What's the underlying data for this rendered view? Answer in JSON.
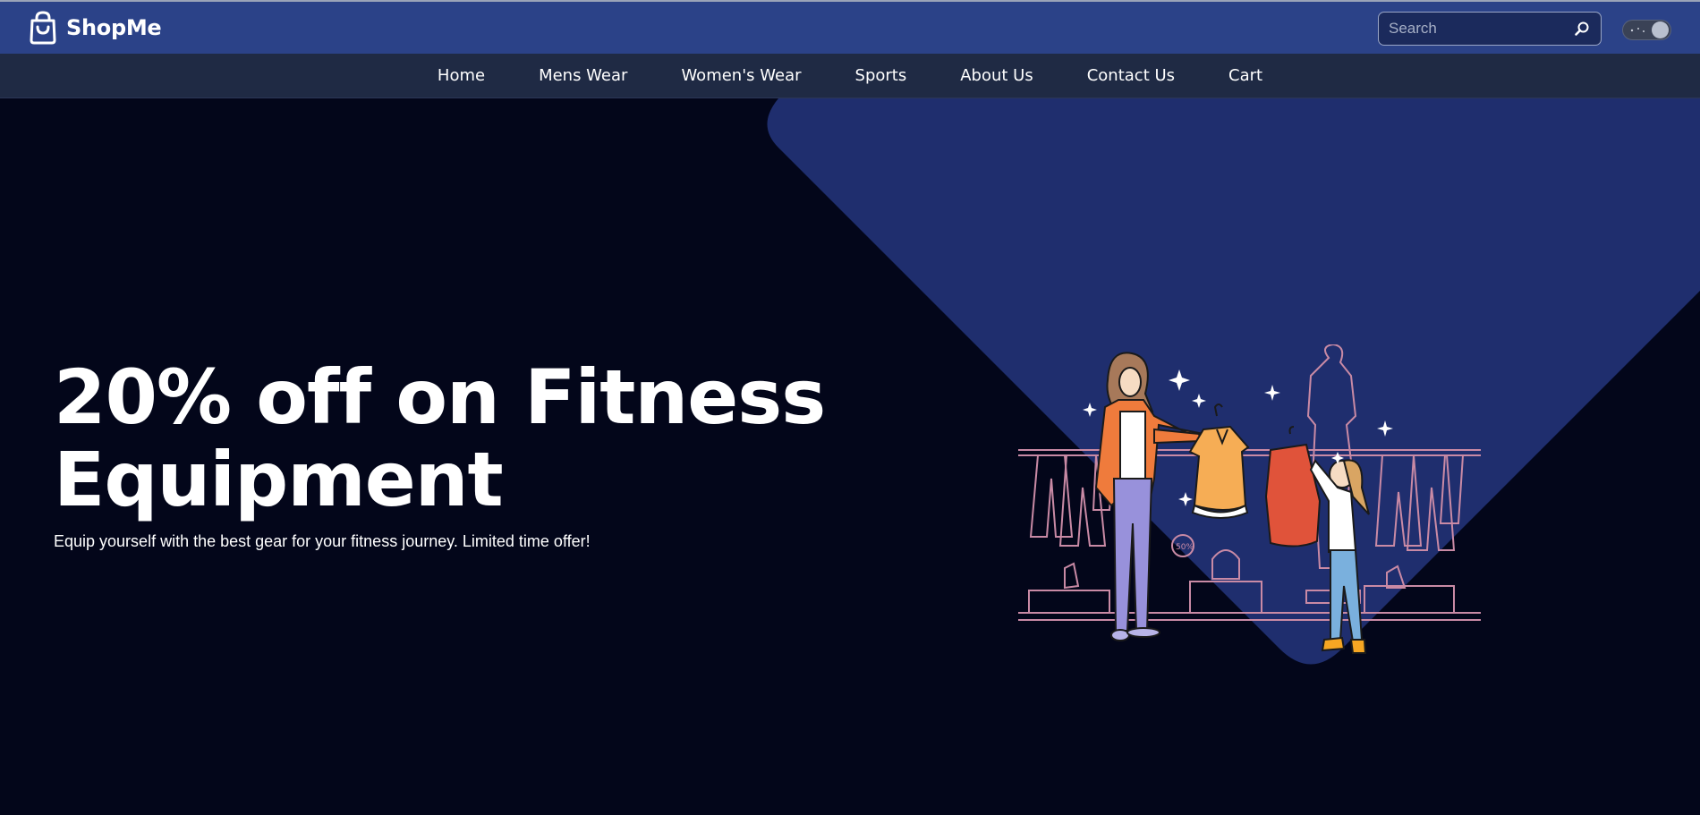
{
  "header": {
    "brand_name": "ShopMe",
    "brand_icon": "shopping-bag-icon",
    "search_placeholder": "Search",
    "search_icon": "search-icon",
    "theme_toggle_icon": "dark-mode-toggle"
  },
  "nav": {
    "items": [
      {
        "label": "Home"
      },
      {
        "label": "Mens Wear"
      },
      {
        "label": "Women's Wear"
      },
      {
        "label": "Sports"
      },
      {
        "label": "About Us"
      },
      {
        "label": "Contact Us"
      },
      {
        "label": "Cart"
      }
    ]
  },
  "hero": {
    "title_line1": "20% off on Fitness",
    "title_line2": "Equipment",
    "subtitle": "Equip yourself with the best gear for your fitness journey. Limited time offer!",
    "illustration": "shopping-clothes-illustration",
    "sale_tag": "50%"
  },
  "colors": {
    "header_bg": "#2b4288",
    "nav_bg": "#1f2a44",
    "page_bg": "#03061a",
    "hero_shape": "#1f2e6e"
  }
}
